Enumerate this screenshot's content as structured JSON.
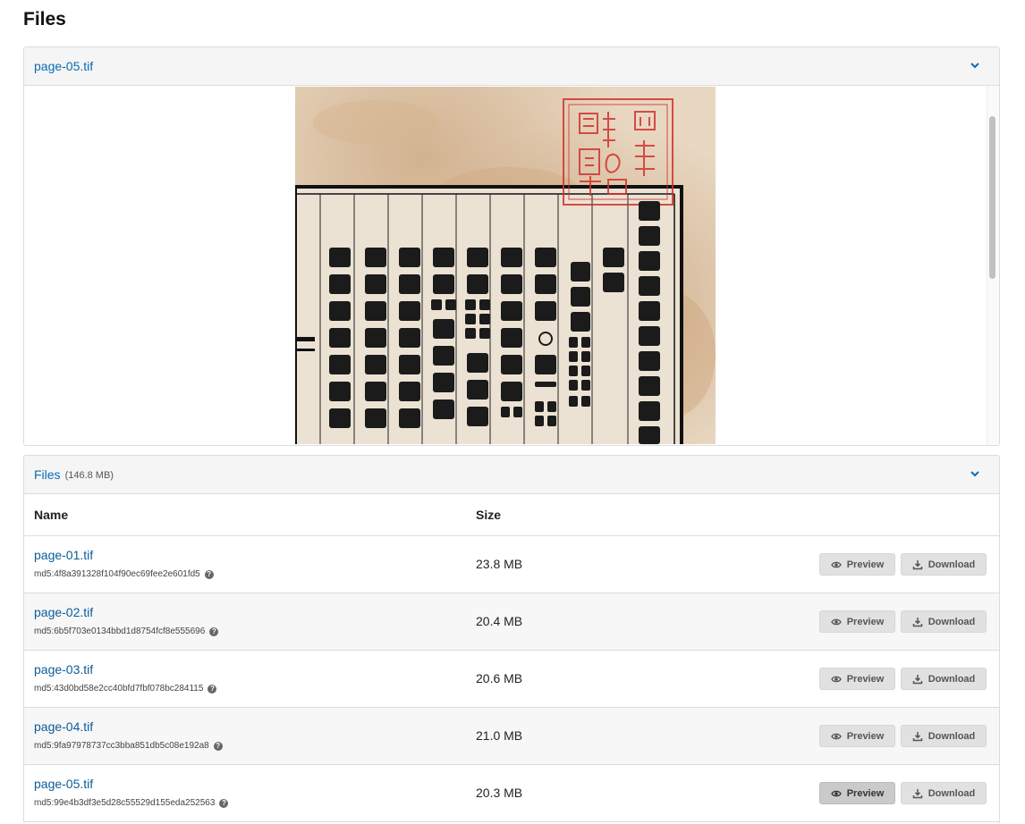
{
  "page": {
    "title": "Files"
  },
  "preview_panel": {
    "title": "page-05.tif"
  },
  "files_panel": {
    "title": "Files",
    "total_size": "(146.8 MB)",
    "columns": {
      "name": "Name",
      "size": "Size"
    },
    "preview_label": "Preview",
    "download_label": "Download",
    "rows": [
      {
        "name": "page-01.tif",
        "md5": "md5:4f8a391328f104f90ec69fee2e601fd5",
        "size": "23.8 MB",
        "selected": false
      },
      {
        "name": "page-02.tif",
        "md5": "md5:6b5f703e0134bbd1d8754fcf8e555696",
        "size": "20.4 MB",
        "selected": false
      },
      {
        "name": "page-03.tif",
        "md5": "md5:43d0bd58e2cc40bfd7fbf078bc284115",
        "size": "20.6 MB",
        "selected": false
      },
      {
        "name": "page-04.tif",
        "md5": "md5:9fa97978737cc3bba851db5c08e192a8",
        "size": "21.0 MB",
        "selected": false
      },
      {
        "name": "page-05.tif",
        "md5": "md5:99e4b3df3e5d28c55529d155eda252563",
        "size": "20.3 MB",
        "selected": true
      }
    ]
  },
  "colors": {
    "link": "#0b6bb5",
    "header_bg": "#f5f5f5",
    "button_bg": "#e1e1e1",
    "seal_red": "#d2332e"
  },
  "icons": {
    "chevron": "chevron-down-icon",
    "preview": "eye-icon",
    "download": "download-icon",
    "help": "question-circle-icon"
  }
}
